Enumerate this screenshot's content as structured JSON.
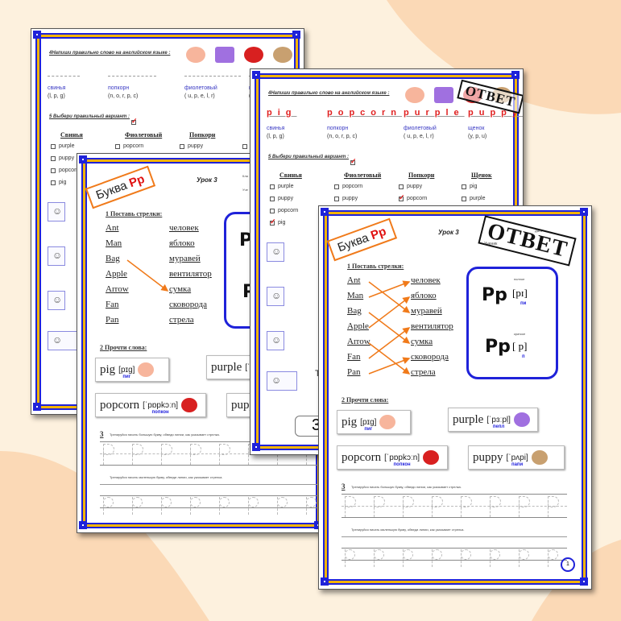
{
  "colors": {
    "background": "#fdf1de",
    "blob": "#fbd9b6",
    "frame_blue": "#1f22d9",
    "frame_yellow": "#f3b400",
    "accent_red": "#e01010",
    "arrow_orange": "#f07a1a"
  },
  "common": {
    "bukva": "Буква",
    "bukva_letter": "Pp",
    "lesson": "Урок 3",
    "answer_stamp": "ОТВЕТ",
    "klass": "Кла",
    "uchenik": "Уче",
    "date_label": "Дата",
    "student_label": "Ученик",
    "task1": "1 Поставь стрелки:",
    "task2": "2 Прочти слова:",
    "task3_num": "3",
    "task3_upper": "Тренируйся писать большую букву, обведи линии, как указывает стрелка.",
    "task3_lower": "Тренируйся писать маленькую букву, обведи линии, как указывает стрелка.",
    "task4": "4Напиши правильно слово  на английском языке :",
    "task5": "5 Выбери правильный вариант :",
    "left_words": [
      "Ant",
      "Man",
      "Bag",
      "Apple",
      "Arrow",
      "Fan",
      "Pan"
    ],
    "right_words": [
      "человек",
      "яблоко",
      "муравей",
      "вентилятор",
      "сумка",
      "сковорода",
      "стрела"
    ],
    "sound_long_label": "полное",
    "sound_long": "[pɪ]",
    "sound_long_ru": "пи",
    "sound_short_label": "краткое",
    "sound_short": "[ p]",
    "sound_short_ru": "п",
    "cards": [
      {
        "word": "pig",
        "ipa": "[pɪg]",
        "ru": "пиг",
        "icon": "pig-icon"
      },
      {
        "word": "purple",
        "ipa": "[ˈpɜːpḷ]",
        "ru": "пепл",
        "icon": "purple-blot-icon"
      },
      {
        "word": "popcorn",
        "ipa": "[ˈpɒpkɔːn]",
        "ru": "попкон",
        "icon": "popcorn-icon"
      },
      {
        "word": "puppy",
        "ipa": "[ˈpʌpi]",
        "ru": "папи",
        "icon": "puppy-icon"
      }
    ],
    "trace_letter_upper": "P",
    "trace_letter_lower": "p",
    "spell": [
      {
        "ru": "свинья",
        "letters": "(l, p, g)",
        "answer": "pig"
      },
      {
        "ru": "попкорн",
        "letters": "(n, o, r, p, c)",
        "answer": "popcorn"
      },
      {
        "ru": "фиолетовый",
        "letters": "( u, p, e, l, r)",
        "answer": "purple"
      },
      {
        "ru": "щенок",
        "letters": "(y, p, u)",
        "answer": "puppy"
      }
    ],
    "choose_cols": [
      {
        "head": "Свинья",
        "opts": [
          "purple",
          "puppy",
          "popcorn",
          "pig"
        ],
        "checked": 3
      },
      {
        "head": "Фиолетовый",
        "opts": [
          "popcorn",
          "puppy"
        ],
        "checked": -1
      },
      {
        "head": "Попкорн",
        "opts": [
          "puppy",
          "popcorn"
        ],
        "checked": 1
      },
      {
        "head": "Щенок",
        "opts": [
          "pig",
          "purple"
        ],
        "checked": -1
      }
    ],
    "page_number": "1",
    "partial_number": "3",
    "partial_t": "Т"
  },
  "answer_arrows": [
    [
      0,
      2
    ],
    [
      1,
      0
    ],
    [
      2,
      4
    ],
    [
      3,
      1
    ],
    [
      4,
      6
    ],
    [
      5,
      3
    ],
    [
      6,
      5
    ]
  ],
  "sample_arrows": [
    [
      2,
      4
    ]
  ]
}
